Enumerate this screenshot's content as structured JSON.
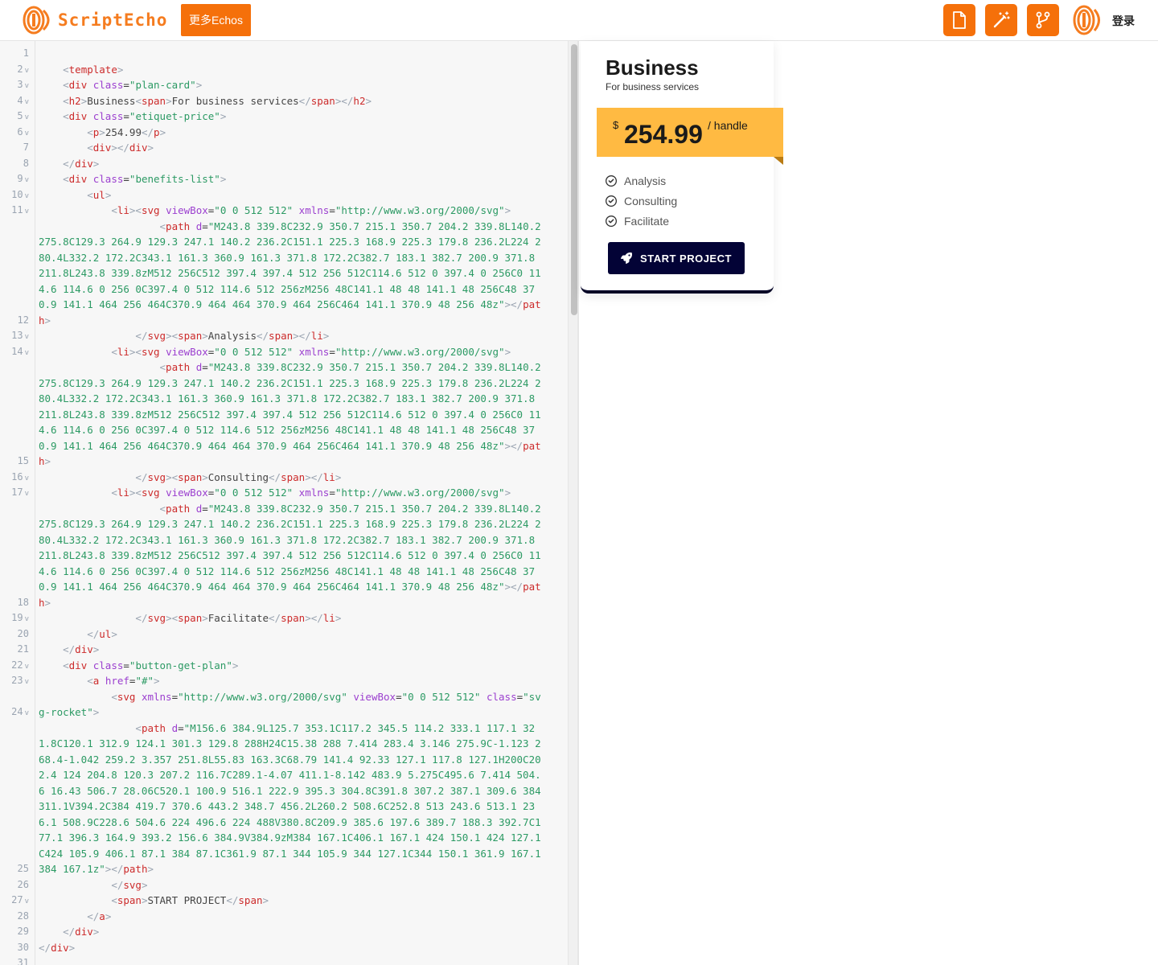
{
  "header": {
    "logo_text": "ScriptEcho",
    "more_button": "更多Echos",
    "tools": [
      {
        "icon": "document-icon"
      },
      {
        "icon": "magic-wand-icon"
      },
      {
        "icon": "git-branch-icon"
      }
    ],
    "login": "登录",
    "accent": "#f5700a"
  },
  "editor": {
    "lines": [
      {
        "n": "1",
        "fold": false,
        "html": ""
      },
      {
        "n": "2",
        "fold": true,
        "html": "    <span class='tk-pun'>&lt;</span><span class='tk-tag'>template</span><span class='tk-pun'>&gt;</span>"
      },
      {
        "n": "3",
        "fold": true,
        "html": "    <span class='tk-pun'>&lt;</span><span class='tk-tag'>div</span> <span class='tk-attr'>class</span>=<span class='tk-val'>\"plan-card\"</span><span class='tk-pun'>&gt;</span>"
      },
      {
        "n": "4",
        "fold": true,
        "html": "    <span class='tk-pun'>&lt;</span><span class='tk-tag'>h2</span><span class='tk-pun'>&gt;</span><span class='tk-txt'>Business</span><span class='tk-pun'>&lt;</span><span class='tk-tag'>span</span><span class='tk-pun'>&gt;</span><span class='tk-txt'>For business services</span><span class='tk-pun'>&lt;/</span><span class='tk-tag'>span</span><span class='tk-pun'>&gt;&lt;/</span><span class='tk-tag'>h2</span><span class='tk-pun'>&gt;</span>"
      },
      {
        "n": "5",
        "fold": true,
        "html": "    <span class='tk-pun'>&lt;</span><span class='tk-tag'>div</span> <span class='tk-attr'>class</span>=<span class='tk-val'>\"etiquet-price\"</span><span class='tk-pun'>&gt;</span>"
      },
      {
        "n": "6",
        "fold": true,
        "html": "        <span class='tk-pun'>&lt;</span><span class='tk-tag'>p</span><span class='tk-pun'>&gt;</span><span class='tk-txt'>254.99</span><span class='tk-pun'>&lt;/</span><span class='tk-tag'>p</span><span class='tk-pun'>&gt;</span>"
      },
      {
        "n": "7",
        "fold": false,
        "html": "        <span class='tk-pun'>&lt;</span><span class='tk-tag'>div</span><span class='tk-pun'>&gt;&lt;/</span><span class='tk-tag'>div</span><span class='tk-pun'>&gt;</span>"
      },
      {
        "n": "8",
        "fold": false,
        "html": "    <span class='tk-pun'>&lt;/</span><span class='tk-tag'>div</span><span class='tk-pun'>&gt;</span>"
      },
      {
        "n": "9",
        "fold": true,
        "html": "    <span class='tk-pun'>&lt;</span><span class='tk-tag'>div</span> <span class='tk-attr'>class</span>=<span class='tk-val'>\"benefits-list\"</span><span class='tk-pun'>&gt;</span>"
      },
      {
        "n": "10",
        "fold": true,
        "html": "        <span class='tk-pun'>&lt;</span><span class='tk-tag'>ul</span><span class='tk-pun'>&gt;</span>"
      },
      {
        "n": "11",
        "fold": true,
        "html": "            <span class='tk-pun'>&lt;</span><span class='tk-tag'>li</span><span class='tk-pun'>&gt;&lt;</span><span class='tk-tag'>svg</span> <span class='tk-attr'>viewBox</span>=<span class='tk-val'>\"0 0 512 512\"</span> <span class='tk-attr'>xmlns</span>=<span class='tk-val'>\"http://www.w3.org/2000/svg\"</span><span class='tk-pun'>&gt;</span>"
      },
      {
        "n": "12",
        "fold": false,
        "html": "                    <span class='tk-pun'>&lt;</span><span class='tk-tag'>path</span> <span class='tk-attr'>d</span>=<span class='tk-val'>\"M243.8 339.8C232.9 350.7 215.1 350.7 204.2 339.8L140.2 275.8C129.3 264.9 129.3 247.1 140.2 236.2C151.1 225.3 168.9 225.3 179.8 236.2L224 280.4L332.2 172.2C343.1 161.3 360.9 161.3 371.8 172.2C382.7 183.1 382.7 200.9 371.8 211.8L243.8 339.8zM512 256C512 397.4 397.4 512 256 512C114.6 512 0 397.4 0 256C0 114.6 114.6 0 256 0C397.4 0 512 114.6 512 256zM256 48C141.1 48 48 141.1 48 256C48 370.9 141.1 464 256 464C370.9 464 464 370.9 464 256C464 141.1 370.9 48 256 48z\"</span><span class='tk-pun'>&gt;&lt;/</span><span class='tk-tag'>path</span><span class='tk-pun'>&gt;</span>"
      },
      {
        "n": "13",
        "fold": true,
        "html": "                <span class='tk-pun'>&lt;/</span><span class='tk-tag'>svg</span><span class='tk-pun'>&gt;&lt;</span><span class='tk-tag'>span</span><span class='tk-pun'>&gt;</span><span class='tk-txt'>Analysis</span><span class='tk-pun'>&lt;/</span><span class='tk-tag'>span</span><span class='tk-pun'>&gt;&lt;/</span><span class='tk-tag'>li</span><span class='tk-pun'>&gt;</span>"
      },
      {
        "n": "14",
        "fold": true,
        "html": "            <span class='tk-pun'>&lt;</span><span class='tk-tag'>li</span><span class='tk-pun'>&gt;&lt;</span><span class='tk-tag'>svg</span> <span class='tk-attr'>viewBox</span>=<span class='tk-val'>\"0 0 512 512\"</span> <span class='tk-attr'>xmlns</span>=<span class='tk-val'>\"http://www.w3.org/2000/svg\"</span><span class='tk-pun'>&gt;</span>"
      },
      {
        "n": "15",
        "fold": false,
        "html": "                    <span class='tk-pun'>&lt;</span><span class='tk-tag'>path</span> <span class='tk-attr'>d</span>=<span class='tk-val'>\"M243.8 339.8C232.9 350.7 215.1 350.7 204.2 339.8L140.2 275.8C129.3 264.9 129.3 247.1 140.2 236.2C151.1 225.3 168.9 225.3 179.8 236.2L224 280.4L332.2 172.2C343.1 161.3 360.9 161.3 371.8 172.2C382.7 183.1 382.7 200.9 371.8 211.8L243.8 339.8zM512 256C512 397.4 397.4 512 256 512C114.6 512 0 397.4 0 256C0 114.6 114.6 0 256 0C397.4 0 512 114.6 512 256zM256 48C141.1 48 48 141.1 48 256C48 370.9 141.1 464 256 464C370.9 464 464 370.9 464 256C464 141.1 370.9 48 256 48z\"</span><span class='tk-pun'>&gt;&lt;/</span><span class='tk-tag'>path</span><span class='tk-pun'>&gt;</span>"
      },
      {
        "n": "16",
        "fold": true,
        "html": "                <span class='tk-pun'>&lt;/</span><span class='tk-tag'>svg</span><span class='tk-pun'>&gt;&lt;</span><span class='tk-tag'>span</span><span class='tk-pun'>&gt;</span><span class='tk-txt'>Consulting</span><span class='tk-pun'>&lt;/</span><span class='tk-tag'>span</span><span class='tk-pun'>&gt;&lt;/</span><span class='tk-tag'>li</span><span class='tk-pun'>&gt;</span>"
      },
      {
        "n": "17",
        "fold": true,
        "html": "            <span class='tk-pun'>&lt;</span><span class='tk-tag'>li</span><span class='tk-pun'>&gt;&lt;</span><span class='tk-tag'>svg</span> <span class='tk-attr'>viewBox</span>=<span class='tk-val'>\"0 0 512 512\"</span> <span class='tk-attr'>xmlns</span>=<span class='tk-val'>\"http://www.w3.org/2000/svg\"</span><span class='tk-pun'>&gt;</span>"
      },
      {
        "n": "18",
        "fold": false,
        "html": "                    <span class='tk-pun'>&lt;</span><span class='tk-tag'>path</span> <span class='tk-attr'>d</span>=<span class='tk-val'>\"M243.8 339.8C232.9 350.7 215.1 350.7 204.2 339.8L140.2 275.8C129.3 264.9 129.3 247.1 140.2 236.2C151.1 225.3 168.9 225.3 179.8 236.2L224 280.4L332.2 172.2C343.1 161.3 360.9 161.3 371.8 172.2C382.7 183.1 382.7 200.9 371.8 211.8L243.8 339.8zM512 256C512 397.4 397.4 512 256 512C114.6 512 0 397.4 0 256C0 114.6 114.6 0 256 0C397.4 0 512 114.6 512 256zM256 48C141.1 48 48 141.1 48 256C48 370.9 141.1 464 256 464C370.9 464 464 370.9 464 256C464 141.1 370.9 48 256 48z\"</span><span class='tk-pun'>&gt;&lt;/</span><span class='tk-tag'>path</span><span class='tk-pun'>&gt;</span>"
      },
      {
        "n": "19",
        "fold": true,
        "html": "                <span class='tk-pun'>&lt;/</span><span class='tk-tag'>svg</span><span class='tk-pun'>&gt;&lt;</span><span class='tk-tag'>span</span><span class='tk-pun'>&gt;</span><span class='tk-txt'>Facilitate</span><span class='tk-pun'>&lt;/</span><span class='tk-tag'>span</span><span class='tk-pun'>&gt;&lt;/</span><span class='tk-tag'>li</span><span class='tk-pun'>&gt;</span>"
      },
      {
        "n": "20",
        "fold": false,
        "html": "        <span class='tk-pun'>&lt;/</span><span class='tk-tag'>ul</span><span class='tk-pun'>&gt;</span>"
      },
      {
        "n": "21",
        "fold": false,
        "html": "    <span class='tk-pun'>&lt;/</span><span class='tk-tag'>div</span><span class='tk-pun'>&gt;</span>"
      },
      {
        "n": "22",
        "fold": true,
        "html": "    <span class='tk-pun'>&lt;</span><span class='tk-tag'>div</span> <span class='tk-attr'>class</span>=<span class='tk-val'>\"button-get-plan\"</span><span class='tk-pun'>&gt;</span>"
      },
      {
        "n": "23",
        "fold": true,
        "html": "        <span class='tk-pun'>&lt;</span><span class='tk-tag'>a</span> <span class='tk-attr'>href</span>=<span class='tk-val'>\"#\"</span><span class='tk-pun'>&gt;</span>"
      },
      {
        "n": "24",
        "fold": true,
        "html": "            <span class='tk-pun'>&lt;</span><span class='tk-tag'>svg</span> <span class='tk-attr'>xmlns</span>=<span class='tk-val'>\"http://www.w3.org/2000/svg\"</span> <span class='tk-attr'>viewBox</span>=<span class='tk-val'>\"0 0 512 512\"</span> <span class='tk-attr'>class</span>=<span class='tk-val'>\"svg-rocket\"</span><span class='tk-pun'>&gt;</span>"
      },
      {
        "n": "25",
        "fold": false,
        "html": "                <span class='tk-pun'>&lt;</span><span class='tk-tag'>path</span> <span class='tk-attr'>d</span>=<span class='tk-val'>\"M156.6 384.9L125.7 353.1C117.2 345.5 114.2 333.1 117.1 321.8C120.1 312.9 124.1 301.3 129.8 288H24C15.38 288 7.414 283.4 3.146 275.9C-1.123 268.4-1.042 259.2 3.357 251.8L55.83 163.3C68.79 141.4 92.33 127.1 117.8 127.1H200C202.4 124 204.8 120.3 207.2 116.7C289.1-4.07 411.1-8.142 483.9 5.275C495.6 7.414 504.6 16.43 506.7 28.06C520.1 100.9 516.1 222.9 395.3 304.8C391.8 307.2 387.1 309.6 384 311.1V394.2C384 419.7 370.6 443.2 348.7 456.2L260.2 508.6C252.8 513 243.6 513.1 236.1 508.9C228.6 504.6 224 496.6 224 488V380.8C209.9 385.6 197.6 389.7 188.3 392.7C177.1 396.3 164.9 393.2 156.6 384.9V384.9zM384 167.1C406.1 167.1 424 150.1 424 127.1C424 105.9 406.1 87.1 384 87.1C361.9 87.1 344 105.9 344 127.1C344 150.1 361.9 167.1 384 167.1z\"</span><span class='tk-pun'>&gt;&lt;/</span><span class='tk-tag'>path</span><span class='tk-pun'>&gt;</span>"
      },
      {
        "n": "26",
        "fold": false,
        "html": "            <span class='tk-pun'>&lt;/</span><span class='tk-tag'>svg</span><span class='tk-pun'>&gt;</span>"
      },
      {
        "n": "27",
        "fold": true,
        "html": "            <span class='tk-pun'>&lt;</span><span class='tk-tag'>span</span><span class='tk-pun'>&gt;</span><span class='tk-txt'>START PROJECT</span><span class='tk-pun'>&lt;/</span><span class='tk-tag'>span</span><span class='tk-pun'>&gt;</span>"
      },
      {
        "n": "28",
        "fold": false,
        "html": "        <span class='tk-pun'>&lt;/</span><span class='tk-tag'>a</span><span class='tk-pun'>&gt;</span>"
      },
      {
        "n": "29",
        "fold": false,
        "html": "    <span class='tk-pun'>&lt;/</span><span class='tk-tag'>div</span><span class='tk-pun'>&gt;</span>"
      },
      {
        "n": "30",
        "fold": false,
        "html": "<span class='tk-pun'>&lt;/</span><span class='tk-tag'>div</span><span class='tk-pun'>&gt;</span>"
      },
      {
        "n": "31",
        "fold": false,
        "html": ""
      }
    ]
  },
  "preview": {
    "title": "Business",
    "subtitle": "For business services",
    "currency": "$",
    "price": "254.99",
    "unit": "/ handle",
    "benefits": [
      "Analysis",
      "Consulting",
      "Facilitate"
    ],
    "cta_label": "START PROJECT",
    "price_color": "#ffba42",
    "cta_color": "#030336"
  }
}
